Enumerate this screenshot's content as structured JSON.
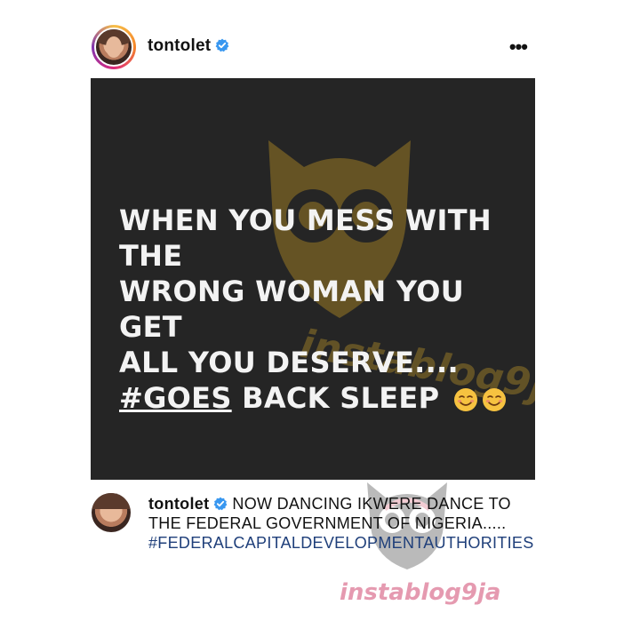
{
  "header": {
    "username": "tontolet",
    "more_label": "•••"
  },
  "post": {
    "lines": [
      "WHEN YOU MESS WITH THE",
      "WRONG WOMAN YOU GET",
      "ALL YOU DESERVE....",
      "BACK SLEEP"
    ],
    "hashtag": "#GOES",
    "emoji_count": 2,
    "watermark": "instablog9ja"
  },
  "caption": {
    "username": "tontolet",
    "text": "NOW DANCING IKWERE DANCE TO THE FEDERAL GOVERNMENT OF NIGERIA.....",
    "hashtag": "#FEDERALCAPITALDEVELOPMENTAUTHORITIES"
  },
  "watermark_bottom": "instablog9ja",
  "colors": {
    "post_bg": "#252525",
    "verified_blue": "#3897f0",
    "hashtag_blue": "#1f3f7a",
    "watermark_gold": "#9a7a24",
    "watermark_pink": "#dc7896"
  },
  "icons": {
    "verified": "verified-badge-icon",
    "more": "more-options-icon",
    "emoji": "smiling-face-icon"
  }
}
